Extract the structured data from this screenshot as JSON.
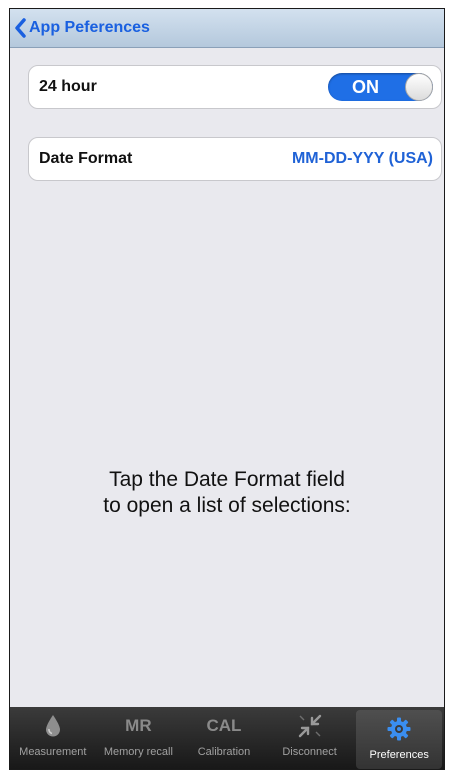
{
  "navbar": {
    "back_label": "App Peferences"
  },
  "settings": {
    "hour24": {
      "label": "24 hour",
      "toggle_text": "ON",
      "enabled": true
    },
    "date_format": {
      "label": "Date Format",
      "value": "MM-DD-YYY (USA)"
    }
  },
  "hint": {
    "line1": "Tap the Date Format field",
    "line2": "to open a list of selections:"
  },
  "tabs": [
    {
      "label": "Measurement",
      "icon": "drop-icon"
    },
    {
      "label": "Memory recall",
      "icon_text": "MR"
    },
    {
      "label": "Calibration",
      "icon_text": "CAL"
    },
    {
      "label": "Disconnect",
      "icon": "disconnect-arrows-icon"
    },
    {
      "label": "Preferences",
      "icon": "gear-icon",
      "active": true
    }
  ],
  "colors": {
    "accent": "#1f6fe6",
    "link_blue": "#1f62d6",
    "background": "#e9e9ee",
    "tabbar": "#242424"
  }
}
